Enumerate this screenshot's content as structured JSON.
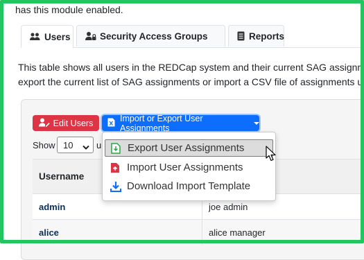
{
  "intro_text": "has this module enabled.",
  "tabs": [
    {
      "label": "Users",
      "icon": "users-icon",
      "active": true
    },
    {
      "label": "Security Access Groups",
      "icon": "user-lock-icon",
      "active": false
    },
    {
      "label": "Reports",
      "icon": "report-icon",
      "active": false
    }
  ],
  "description": {
    "line1": "This table shows all users in the REDCap system and their current SAG assignme",
    "line2": "export the current list of SAG assignments or import a CSV file of assignments u"
  },
  "toolbar": {
    "edit_users_label": "Edit Users",
    "import_export_label": "Import or Export User Assignments"
  },
  "dropdown": {
    "items": [
      {
        "label": "Export User Assignments",
        "icon": "file-export-icon"
      },
      {
        "label": "Import User Assignments",
        "icon": "file-import-icon"
      },
      {
        "label": "Download Import Template",
        "icon": "download-icon"
      }
    ]
  },
  "length_control": {
    "show_label": "Show",
    "selected_value": "10",
    "entries_label": "u"
  },
  "table": {
    "columns": [
      "Username",
      ""
    ],
    "rows": [
      {
        "username": "admin",
        "name": "joe admin"
      },
      {
        "username": "alice",
        "name": "alice manager"
      }
    ]
  },
  "colors": {
    "border_accent": "#22c55e",
    "danger": "#dc3545",
    "primary": "#0d6efd"
  }
}
